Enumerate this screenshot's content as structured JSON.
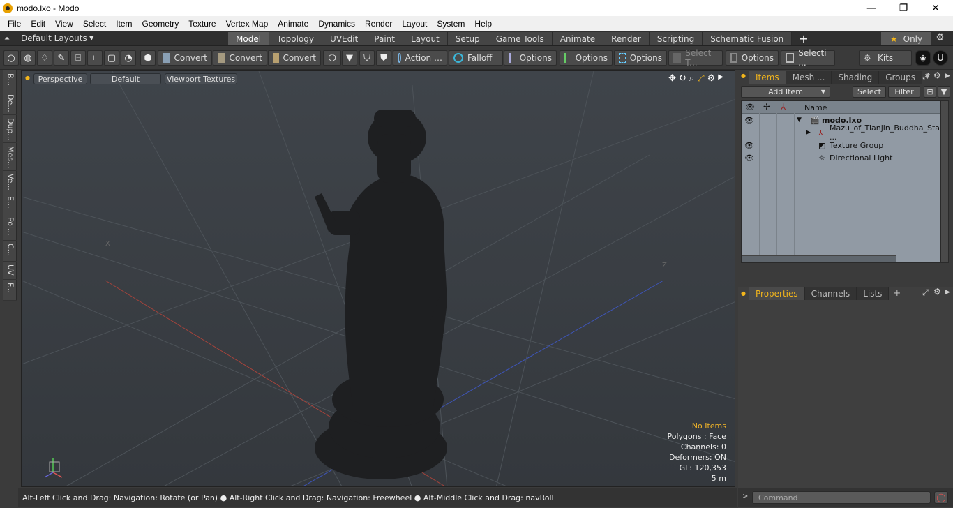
{
  "window": {
    "title": "modo.lxo - Modo",
    "controls": [
      "—",
      "❐",
      "✕"
    ]
  },
  "menu": [
    "File",
    "Edit",
    "View",
    "Select",
    "Item",
    "Geometry",
    "Texture",
    "Vertex Map",
    "Animate",
    "Dynamics",
    "Render",
    "Layout",
    "System",
    "Help"
  ],
  "layoutbar": {
    "layout_label": "Default Layouts",
    "tabs": [
      "Model",
      "Topology",
      "UVEdit",
      "Paint",
      "Layout",
      "Setup",
      "Game Tools",
      "Animate",
      "Render",
      "Scripting",
      "Schematic Fusion"
    ],
    "active_tab": "Model",
    "only_label": "Only"
  },
  "toolbar": {
    "convert1": "Convert",
    "convert2": "Convert",
    "convert3": "Convert",
    "action": "Action",
    "falloff": "Falloff",
    "options1": "Options",
    "options2": "Options",
    "options3": "Options",
    "options4": "Options",
    "select_t": "Select T...",
    "selecti": "Selecti ...",
    "kits": "Kits"
  },
  "lefttabs": [
    "B...",
    "De...",
    "Dup...",
    "Mes...",
    "Ve...",
    "E...",
    "Pol...",
    "C...",
    "UV",
    "F..."
  ],
  "viewport": {
    "perspective": "Perspective",
    "default": "Default",
    "textures": "Viewport Textures",
    "axis_x_label": "X",
    "axis_z_label": "Z",
    "stats": {
      "no_items": "No Items",
      "polygons": "Polygons : Face",
      "channels": "Channels: 0",
      "deformers": "Deformers: ON",
      "gl": "GL: 120,353",
      "scale": "5 m"
    }
  },
  "statusbar": {
    "text": "Alt-Left Click and Drag: Navigation: Rotate (or Pan) ● Alt-Right Click and Drag: Navigation: Freewheel ● Alt-Middle Click and Drag: navRoll"
  },
  "items_panel": {
    "tabs": [
      "Items",
      "Mesh ...",
      "Shading",
      "Groups"
    ],
    "active_tab": "Items",
    "add_item": "Add Item",
    "select": "Select",
    "filter": "Filter",
    "column_name": "Name",
    "rows": [
      {
        "label": "modo.lxo",
        "visible": true,
        "bold": true
      },
      {
        "label": "Mazu_of_Tianjin_Buddha_Sta ...",
        "visible": false,
        "bold": false
      },
      {
        "label": "Texture Group",
        "visible": true,
        "bold": false
      },
      {
        "label": "Directional Light",
        "visible": true,
        "bold": false
      }
    ]
  },
  "props_panel": {
    "tabs": [
      "Properties",
      "Channels",
      "Lists"
    ],
    "active_tab": "Properties"
  },
  "command": {
    "placeholder": "Command"
  },
  "colors": {
    "accent": "#f2b51c",
    "viewport_bg": "#3a3f45",
    "item_list_bg": "#919aa4"
  }
}
